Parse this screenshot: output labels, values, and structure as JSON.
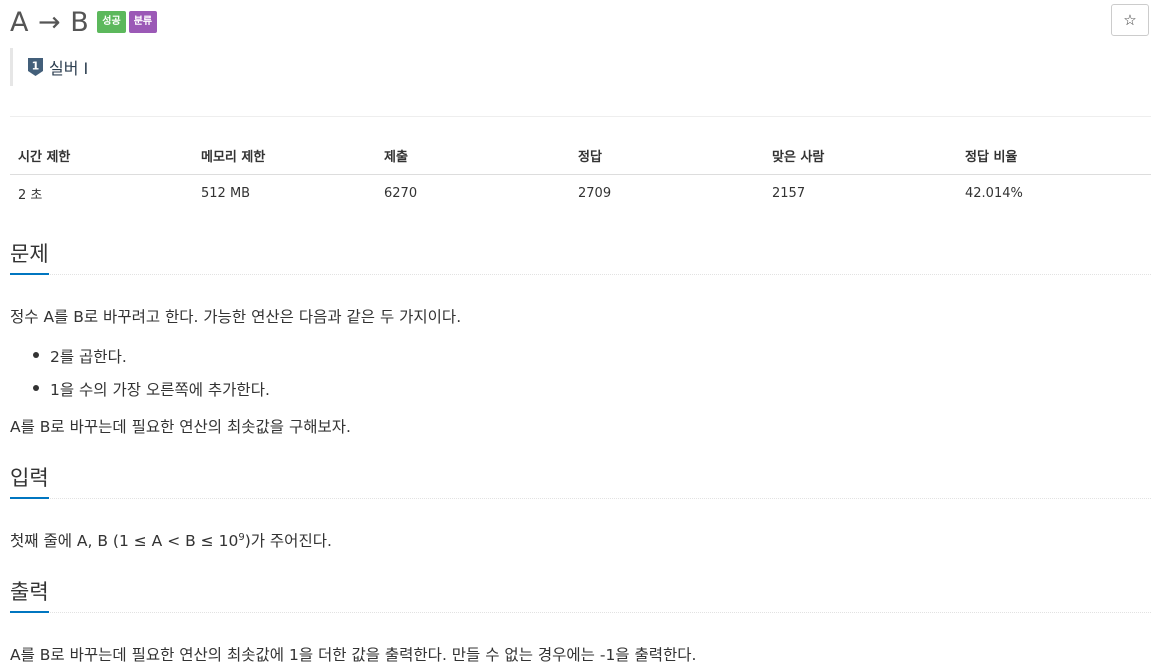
{
  "problem": {
    "title": "A → B",
    "badges": [
      {
        "label": "성공",
        "color": "#5cb85c"
      },
      {
        "label": "분류",
        "color": "#9b59b6"
      }
    ],
    "star_icon": "star-icon",
    "star_glyph": "☆",
    "tier": {
      "number": "1",
      "label": "실버 I",
      "color": "#435f7a"
    }
  },
  "info_table": {
    "headers": [
      "시간 제한",
      "메모리 제한",
      "제출",
      "정답",
      "맞은 사람",
      "정답 비율"
    ],
    "values": [
      "2 초",
      "512 MB",
      "6270",
      "2709",
      "2157",
      "42.014%"
    ]
  },
  "sections": {
    "description": {
      "heading": "문제",
      "intro": "정수 A를 B로 바꾸려고 한다. 가능한 연산은 다음과 같은 두 가지이다.",
      "items": [
        "2를 곱한다.",
        "1을 수의 가장 오른쪽에 추가한다."
      ],
      "outro": "A를 B로 바꾸는데 필요한 연산의 최솟값을 구해보자."
    },
    "input": {
      "heading": "입력",
      "text_before": "첫째 줄에 A, B (1 ≤ A < B ≤ 10",
      "sup": "9",
      "text_after": ")가 주어진다."
    },
    "output": {
      "heading": "출력",
      "text": "A를 B로 바꾸는데 필요한 연산의 최솟값에 1을 더한 값을 출력한다. 만들 수 없는 경우에는 -1을 출력한다."
    }
  },
  "colors": {
    "accent": "#0076c0",
    "success": "#5cb85c",
    "category": "#9b59b6",
    "tier": "#435f7a"
  }
}
